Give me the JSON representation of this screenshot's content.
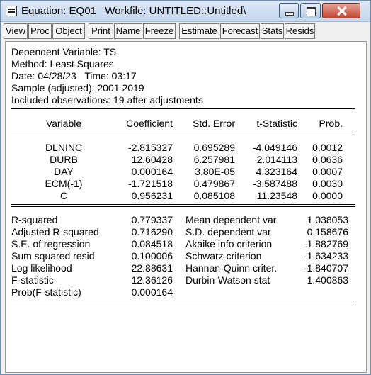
{
  "window": {
    "title": "Equation: EQ01   Workfile: UNTITLED::Untitled\\"
  },
  "toolbar": {
    "buttons": [
      "View",
      "Proc",
      "Object",
      "Print",
      "Name",
      "Freeze",
      "Estimate",
      "Forecast",
      "Stats",
      "Resids"
    ]
  },
  "header": {
    "dependent": "Dependent Variable: TS",
    "method": "Method: Least Squares",
    "datetime": "Date: 04/28/23   Time: 03:17",
    "sample": "Sample (adjusted): 2001 2019",
    "observations": "Included observations: 19 after adjustments"
  },
  "coef_table": {
    "columns": [
      "Variable",
      "Coefficient",
      "Std. Error",
      "t-Statistic",
      "Prob."
    ],
    "rows": [
      [
        "DLNINC",
        "-2.815327",
        "0.695289",
        "-4.049146",
        "0.0012"
      ],
      [
        "DURB",
        "12.60428",
        "6.257981",
        "2.014113",
        "0.0636"
      ],
      [
        "DAY",
        "0.000164",
        "3.80E-05",
        "4.323164",
        "0.0007"
      ],
      [
        "ECM(-1)",
        "-1.721518",
        "0.479867",
        "-3.587488",
        "0.0030"
      ],
      [
        "C",
        "0.956231",
        "0.085108",
        "11.23548",
        "0.0000"
      ]
    ]
  },
  "stats": {
    "left": [
      {
        "label": "R-squared",
        "value": "0.779337"
      },
      {
        "label": "Adjusted R-squared",
        "value": "0.716290"
      },
      {
        "label": "S.E. of regression",
        "value": "0.084518"
      },
      {
        "label": "Sum squared resid",
        "value": "0.100006"
      },
      {
        "label": "Log likelihood",
        "value": "22.88631"
      },
      {
        "label": "F-statistic",
        "value": "12.36126"
      },
      {
        "label": "Prob(F-statistic)",
        "value": "0.000164"
      }
    ],
    "right": [
      {
        "label": "Mean dependent var",
        "value": "1.038053"
      },
      {
        "label": "S.D. dependent var",
        "value": "0.158676"
      },
      {
        "label": "Akaike info criterion",
        "value": "-1.882769"
      },
      {
        "label": "Schwarz criterion",
        "value": "-1.634233"
      },
      {
        "label": "Hannan-Quinn criter.",
        "value": "-1.840707"
      },
      {
        "label": "Durbin-Watson stat",
        "value": "1.400863"
      }
    ]
  }
}
